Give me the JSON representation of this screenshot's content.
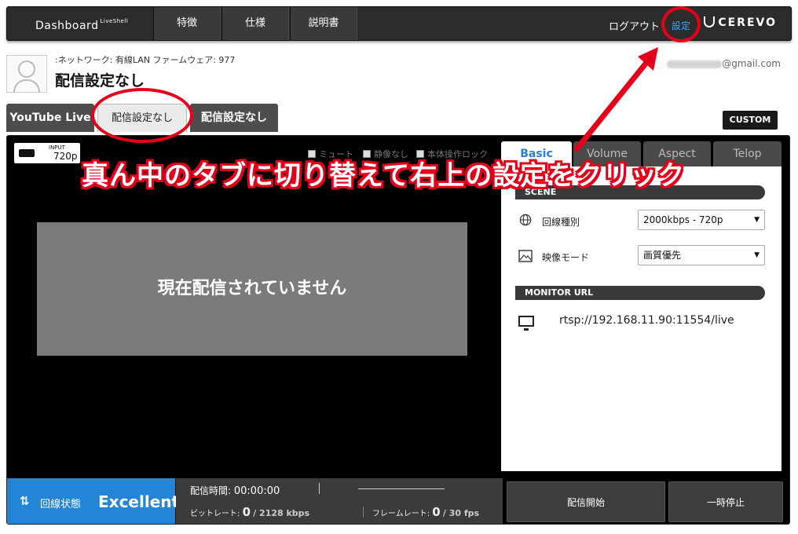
{
  "nav": {
    "brand": "Dashboard",
    "brand_sup": "LiveShell",
    "tabs": [
      "特徴",
      "仕様",
      "説明書"
    ],
    "logout": "ログアウト",
    "settings": "設定",
    "vendor": "CEREVO"
  },
  "profile": {
    "network_info": ":ネットワーク: 有線LAN ファームウェア: 977",
    "title": "配信設定なし",
    "email_suffix": "@gmail.com"
  },
  "profile_tabs": [
    "YouTube Live",
    "配信設定なし",
    "配信設定なし"
  ],
  "custom_button": "CUSTOM",
  "input": {
    "label": "INPUT",
    "resolution": "720p"
  },
  "video_controls": [
    "ミュート",
    "静像なし",
    "本体操作ロック"
  ],
  "preview": {
    "message": "現在配信されていません"
  },
  "right_tabs": [
    "Basic",
    "Volume",
    "Aspect",
    "Telop"
  ],
  "scene": {
    "header": "SCENE",
    "line_type_label": "回線種別",
    "line_type_value": "2000kbps - 720p",
    "video_mode_label": "映像モード",
    "video_mode_value": "画質優先"
  },
  "monitor": {
    "header": "MONITOR URL",
    "url": "rtsp://192.168.11.90:11554/live"
  },
  "status": {
    "line_label": "回線状態",
    "line_value": "Excellent",
    "time_label": "配信時間:",
    "time_value": "00:00:00",
    "bitrate_label": "ビットレート:",
    "bitrate_value": "0",
    "bitrate_max": "/ 2128 kbps",
    "framerate_label": "フレームレート:",
    "framerate_value": "0",
    "framerate_max": "/ 30 fps"
  },
  "actions": {
    "start": "配信開始",
    "pause": "一時停止"
  },
  "annotation": {
    "callout": "真ん中のタブに切り替えて右上の設定をクリック"
  },
  "colors": {
    "accent_blue": "#2385d6",
    "annotation_red": "#e4001b"
  }
}
